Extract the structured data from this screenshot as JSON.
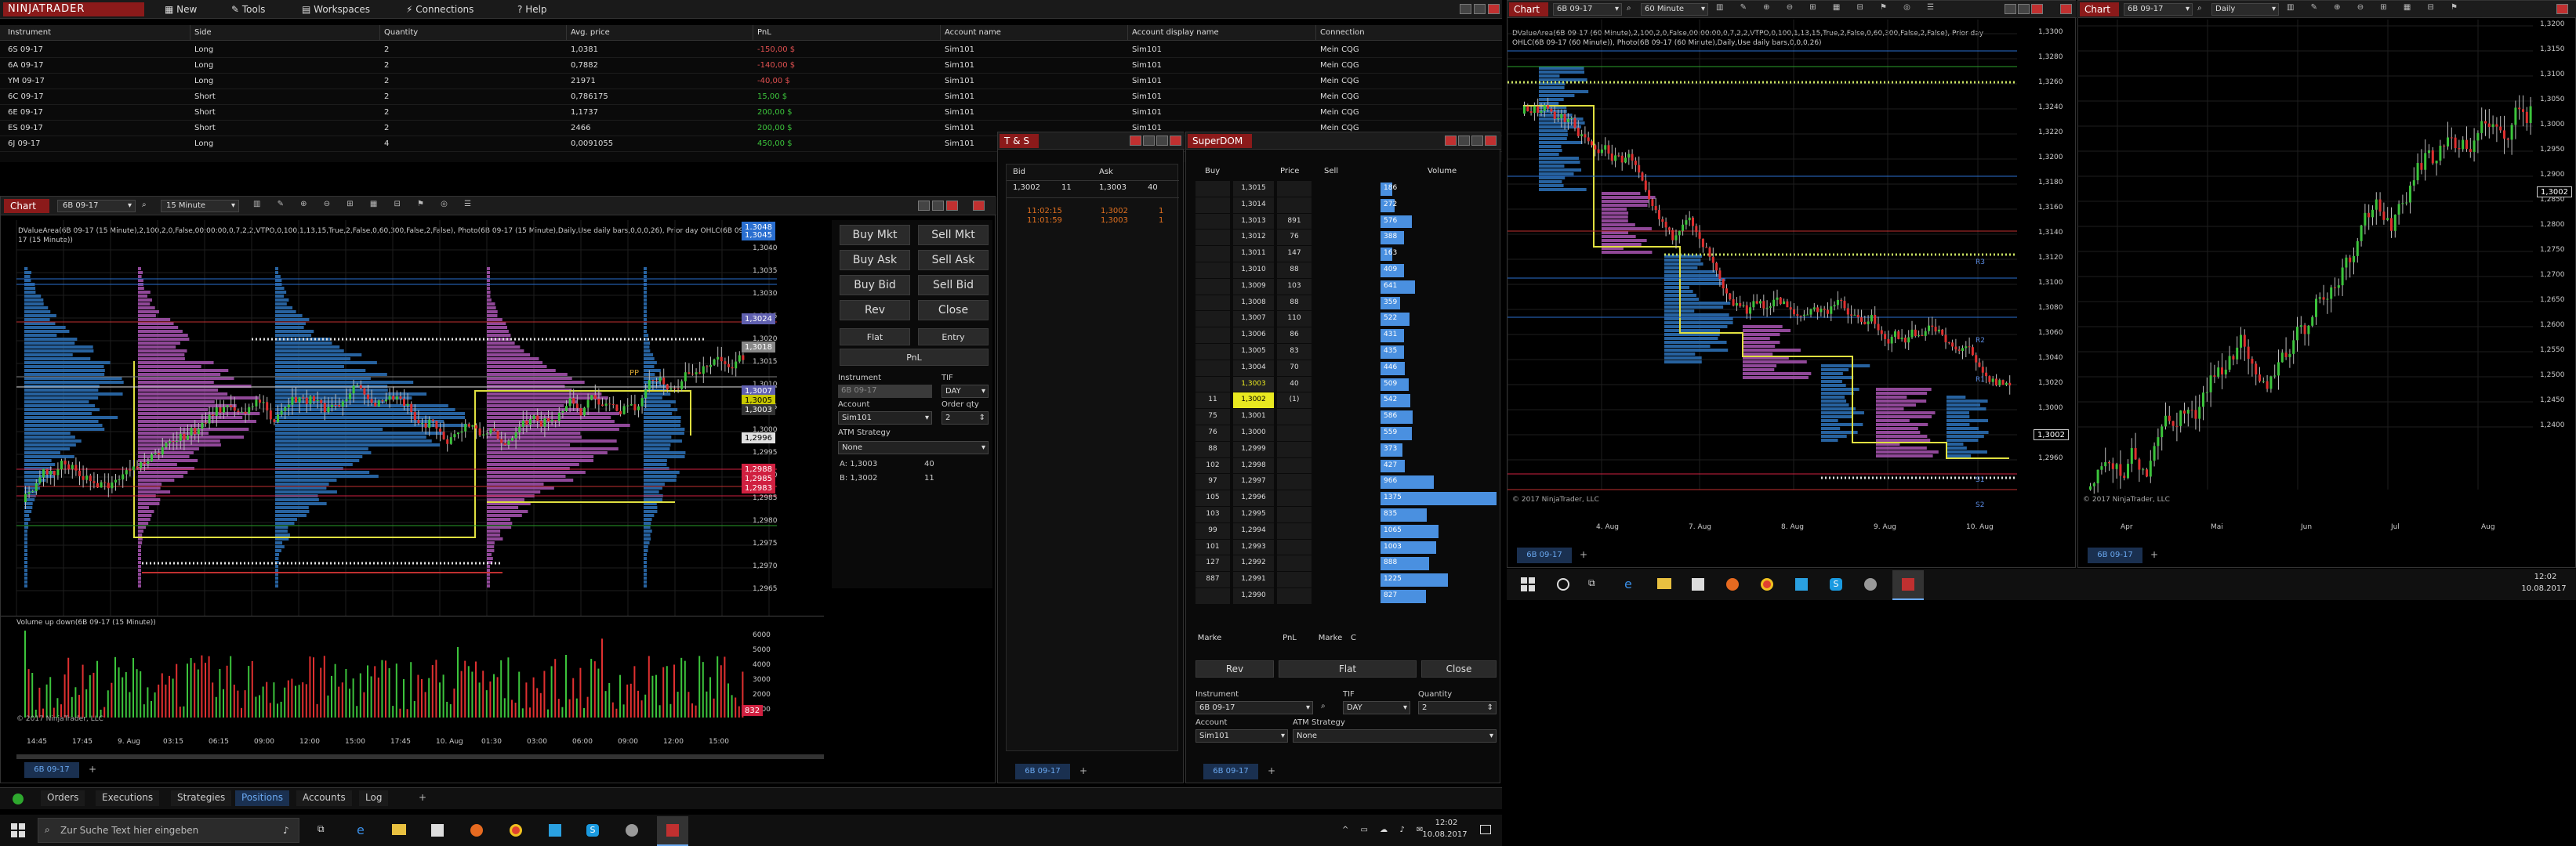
{
  "menu": {
    "logo": "NINJATRADER",
    "items": [
      "New",
      "Tools",
      "Workspaces",
      "Connections",
      "Help"
    ]
  },
  "positions": {
    "headers": [
      "Instrument",
      "Side",
      "Quantity",
      "Avg. price",
      "PnL",
      "Account name",
      "Account display name",
      "Connection"
    ],
    "rows": [
      [
        "6S 09-17",
        "Long",
        "2",
        "1,0381",
        "-150,00 $",
        "Sim101",
        "Sim101",
        "Mein CQG"
      ],
      [
        "6A 09-17",
        "Long",
        "2",
        "0,7882",
        "-140,00 $",
        "Sim101",
        "Sim101",
        "Mein CQG"
      ],
      [
        "YM 09-17",
        "Long",
        "2",
        "21971",
        "-40,00 $",
        "Sim101",
        "Sim101",
        "Mein CQG"
      ],
      [
        "6C 09-17",
        "Short",
        "2",
        "0,786175",
        "15,00 $",
        "Sim101",
        "Sim101",
        "Mein CQG"
      ],
      [
        "6E 09-17",
        "Short",
        "2",
        "1,1737",
        "200,00 $",
        "Sim101",
        "Sim101",
        "Mein CQG"
      ],
      [
        "ES 09-17",
        "Short",
        "2",
        "2466",
        "200,00 $",
        "Sim101",
        "Sim101",
        "Mein CQG"
      ],
      [
        "6J 09-17",
        "Long",
        "4",
        "0,0091055",
        "450,00 $",
        "Sim101",
        "Sim101",
        "Mein CQG"
      ]
    ],
    "pnl_colors": [
      "#e05050",
      "#e05050",
      "#e05050",
      "#3cc43c",
      "#3cc43c",
      "#3cc43c",
      "#3cc43c"
    ]
  },
  "chart1": {
    "title": "Chart",
    "instrument": "6B 09-17",
    "interval": "15 Minute",
    "info": "DValueArea(6B 09-17 (15 Minute),2,100,2,0,False,00:00:00,0,7,2,2,VTPO,0,100,1,13,15,True,2,False,0,60,300,False,2,False), Photo(6B 09-17 (15 Minute),Daily,Use daily bars,0,0,0,26), Prior day OHLC(6B 09-17 (15 Minute))",
    "price_ticks": [
      "1,3040",
      "1,3035",
      "1,3030",
      "1,3025",
      "1,3020",
      "1,3015",
      "1,3010",
      "1,3005",
      "1,3000",
      "1,2995",
      "1,2990",
      "1,2985",
      "1,2980",
      "1,2975",
      "1,2970",
      "1,2965"
    ],
    "tags": [
      {
        "t": "1,3048",
        "c": "#2a6fd0"
      },
      {
        "t": "1,3045",
        "c": "#2a6fd0"
      },
      {
        "t": "1,3024",
        "c": "#6060b0"
      },
      {
        "t": "1,3018",
        "c": "#888888"
      },
      {
        "t": "1,3007",
        "c": "#6060b0"
      },
      {
        "t": "1,3005",
        "c": "#c8c800"
      },
      {
        "t": "1,3003",
        "c": "#333333"
      },
      {
        "t": "1,2996",
        "c": "#e0e0e0"
      },
      {
        "t": "1,2988",
        "c": "#d02040"
      },
      {
        "t": "1,2985",
        "c": "#d02040"
      },
      {
        "t": "1,2983",
        "c": "#d02040"
      }
    ],
    "pp": "PP",
    "time_ticks": [
      "14:45",
      "17:45",
      "9. Aug",
      "03:15",
      "06:15",
      "09:00",
      "12:00",
      "15:00",
      "17:45",
      "10. Aug",
      "01:30",
      "03:00",
      "06:00",
      "09:00",
      "12:00",
      "15:00"
    ],
    "copyright": "© 2017 NinjaTrader, LLC",
    "volume_title": "Volume up down(6B 09-17 (15 Minute))",
    "vol_ticks": [
      "6000",
      "5000",
      "4000",
      "3000",
      "2000",
      "1000"
    ],
    "vol_tag": "832",
    "tab": "6B 09-17"
  },
  "order_panel": {
    "buttons": [
      [
        "Buy Mkt",
        "Sell Mkt"
      ],
      [
        "Buy Ask",
        "Sell Ask"
      ],
      [
        "Buy Bid",
        "Sell Bid"
      ],
      [
        "Rev",
        "Close"
      ]
    ],
    "flat": "Flat",
    "entry": "Entry",
    "pnl": "PnL",
    "instrument_label": "Instrument",
    "instrument": "6B 09-17",
    "tif_label": "TIF",
    "tif": "DAY",
    "account_label": "Account",
    "account": "Sim101",
    "qty_label": "Order qty",
    "qty": "2",
    "atm_label": "ATM Strategy",
    "atm": "None",
    "a_label": "A:",
    "a_price": "1,3003",
    "a_size": "40",
    "b_label": "B:",
    "b_price": "1,3002",
    "b_size": "11"
  },
  "tns": {
    "title": "T & S",
    "headers": [
      "Bid",
      "Ask"
    ],
    "top": [
      "1,3002",
      "11",
      "1,3003",
      "40"
    ],
    "rows": [
      [
        "11:02:15",
        "1,3002",
        "1"
      ],
      [
        "11:01:59",
        "1,3003",
        "1"
      ]
    ],
    "tab": "6B 09-17"
  },
  "superdom": {
    "title": "SuperDOM",
    "headers": [
      "Buy",
      "Price",
      "Sell",
      "Volume"
    ],
    "rows": [
      [
        "",
        "1,3015",
        "",
        "186"
      ],
      [
        "",
        "1,3014",
        "",
        "272"
      ],
      [
        "",
        "1,3013",
        "891",
        "576"
      ],
      [
        "",
        "1,3012",
        "76",
        "388"
      ],
      [
        "",
        "1,3011",
        "147",
        "163"
      ],
      [
        "",
        "1,3010",
        "88",
        "409"
      ],
      [
        "",
        "1,3009",
        "103",
        "641"
      ],
      [
        "",
        "1,3008",
        "88",
        "359"
      ],
      [
        "",
        "1,3007",
        "110",
        "522"
      ],
      [
        "",
        "1,3006",
        "86",
        "431"
      ],
      [
        "",
        "1,3005",
        "83",
        "435"
      ],
      [
        "",
        "1,3004",
        "70",
        "446"
      ],
      [
        "",
        "1,3003",
        "40",
        "509"
      ],
      [
        "11",
        "1,3002",
        "(1)",
        "542"
      ],
      [
        "75",
        "1,3001",
        "",
        "586"
      ],
      [
        "76",
        "1,3000",
        "",
        "559"
      ],
      [
        "88",
        "1,2999",
        "",
        "373"
      ],
      [
        "102",
        "1,2998",
        "",
        "427"
      ],
      [
        "97",
        "1,2997",
        "",
        "966"
      ],
      [
        "105",
        "1,2996",
        "",
        "1375"
      ],
      [
        "103",
        "1,2995",
        "",
        "835"
      ],
      [
        "99",
        "1,2994",
        "",
        "1065"
      ],
      [
        "101",
        "1,2993",
        "",
        "1003"
      ],
      [
        "127",
        "1,2992",
        "",
        "888"
      ],
      [
        "887",
        "1,2991",
        "",
        "1225"
      ],
      [
        "",
        "1,2990",
        "",
        "827"
      ]
    ],
    "vol_fracs": [
      0.1,
      0.12,
      0.27,
      0.2,
      0.1,
      0.2,
      0.3,
      0.17,
      0.25,
      0.2,
      0.2,
      0.21,
      0.24,
      0.26,
      0.28,
      0.27,
      0.19,
      0.21,
      0.46,
      1.0,
      0.4,
      0.5,
      0.48,
      0.42,
      0.58,
      0.39
    ],
    "bottom": [
      "Marke",
      "PnL",
      "Marke",
      "C"
    ],
    "rev": "Rev",
    "flat": "Flat",
    "close": "Close",
    "instrument_label": "Instrument",
    "instrument": "6B 09-17",
    "tif_label": "TIF",
    "tif": "DAY",
    "qty_label": "Quantity",
    "qty": "2",
    "account_label": "Account",
    "account": "Sim101",
    "atm_label": "ATM Strategy",
    "atm": "None",
    "tab": "6B 09-17"
  },
  "bottom_tabs": {
    "items": [
      "Orders",
      "Executions",
      "Strategies",
      "Positions",
      "Accounts",
      "Log"
    ],
    "active": "Positions"
  },
  "chart2": {
    "title": "Chart",
    "instrument": "6B 09-17",
    "interval": "60 Minute",
    "info": "DValueArea(6B 09-17 (60 Minute),2,100,2,0,False,00:00:00,0,7,2,2,VTPO,0,100,1,13,15,True,2,False,0,60,300,False,2,False), Prior day OHLC(6B 09-17 (60 Minute)), Photo(6B 09-17 (60 Minute),Daily,Use daily bars,0,0,0,26)",
    "price_ticks": [
      "1,3300",
      "1,3280",
      "1,3260",
      "1,3240",
      "1,3220",
      "1,3200",
      "1,3180",
      "1,3160",
      "1,3140",
      "1,3120",
      "1,3100",
      "1,3080",
      "1,3060",
      "1,3040",
      "1,3020",
      "1,3000",
      "1,2980",
      "1,2960"
    ],
    "tag": "1,3002",
    "levels": [
      "R3",
      "R2",
      "R1",
      "S1",
      "S2"
    ],
    "time_ticks": [
      "4. Aug",
      "7. Aug",
      "8. Aug",
      "9. Aug",
      "10. Aug"
    ],
    "copyright": "© 2017 NinjaTrader, LLC",
    "tab": "6B 09-17"
  },
  "chart3": {
    "title": "Chart",
    "instrument": "6B 09-17",
    "interval": "Daily",
    "price_ticks": [
      "1,3200",
      "1,3100",
      "1,3000",
      "1,2900",
      "1,2800",
      "1,2700",
      "1,2600",
      "1,2500",
      "1,2400",
      "1,2300"
    ],
    "price_ticks_full": [
      "1,3200",
      "1,3150",
      "1,3100",
      "1,3050",
      "1,3000",
      "1,2950",
      "1,2900",
      "1,2850",
      "1,2800",
      "1,2750",
      "1,2700",
      "1,2650",
      "1,2600",
      "1,2550",
      "1,2500",
      "1,2450",
      "1,2400"
    ],
    "tag": "1,3002",
    "time_ticks": [
      "Apr",
      "Mai",
      "Jun",
      "Jul",
      "Aug"
    ],
    "copyright": "© 2017 NinjaTrader, LLC",
    "tab": "6B 09-17"
  },
  "taskbar_left": {
    "search_placeholder": "Zur Suche Text hier eingeben",
    "time": "12:02",
    "date": "10.08.2017"
  },
  "taskbar_right": {
    "time": "12:02",
    "date": "10.08.2017"
  }
}
